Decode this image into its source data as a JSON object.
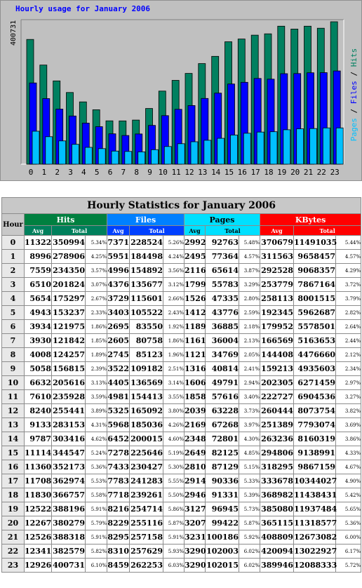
{
  "chart_title": "Hourly usage for January 2006",
  "table_title": "Hourly Statistics for January 2006",
  "headers": {
    "hour": "Hour",
    "hits": "Hits",
    "files": "Files",
    "pages": "Pages",
    "kbytes": "KBytes",
    "avg": "Avg",
    "total": "Total"
  },
  "colors": {
    "hits": "#008040",
    "files": "#0000ff",
    "pages": "#00c0ff",
    "kbytes": "#ff0000"
  },
  "chart_data": {
    "type": "bar",
    "title": "Hourly usage for January 2006",
    "categories": [
      "0",
      "1",
      "2",
      "3",
      "4",
      "5",
      "6",
      "7",
      "8",
      "9",
      "10",
      "11",
      "12",
      "13",
      "14",
      "15",
      "16",
      "17",
      "18",
      "19",
      "20",
      "21",
      "22",
      "23"
    ],
    "ymax_label": "400731",
    "ylim": [
      0,
      400731
    ],
    "legend": "Pages / Files / Hits",
    "series": [
      {
        "name": "Hits",
        "values": [
          350994,
          278906,
          234350,
          201824,
          175297,
          153237,
          121975,
          121842,
          124257,
          156815,
          205616,
          235928,
          255441,
          283153,
          303416,
          344547,
          352173,
          362974,
          366757,
          388196,
          380279,
          388318,
          382579,
          400731
        ]
      },
      {
        "name": "Files",
        "values": [
          228524,
          184498,
          154892,
          135677,
          115601,
          105522,
          85500,
          80758,
          85123,
          109182,
          136569,
          154413,
          165092,
          185036,
          200015,
          225646,
          230427,
          241283,
          239261,
          254714,
          255116,
          257158,
          257629,
          262253
        ]
      },
      {
        "name": "Pages",
        "values": [
          92763,
          77364,
          65614,
          55783,
          47335,
          43776,
          36885,
          36004,
          34769,
          40814,
          49791,
          57616,
          63228,
          67268,
          72801,
          82125,
          87129,
          90336,
          91331,
          96945,
          99422,
          100186,
          102003,
          102015
        ]
      }
    ]
  },
  "rows": [
    {
      "hour": "0",
      "hits_avg": "11322",
      "hits_total": "350994",
      "hits_pct": "5.34%",
      "files_avg": "7371",
      "files_total": "228524",
      "files_pct": "5.26%",
      "pages_avg": "2992",
      "pages_total": "92763",
      "pages_pct": "5.48%",
      "kb_avg": "370679",
      "kb_total": "11491035",
      "kb_pct": "5.44%"
    },
    {
      "hour": "1",
      "hits_avg": "8996",
      "hits_total": "278906",
      "hits_pct": "4.25%",
      "files_avg": "5951",
      "files_total": "184498",
      "files_pct": "4.24%",
      "pages_avg": "2495",
      "pages_total": "77364",
      "pages_pct": "4.57%",
      "kb_avg": "311563",
      "kb_total": "9658457",
      "kb_pct": "4.57%"
    },
    {
      "hour": "2",
      "hits_avg": "7559",
      "hits_total": "234350",
      "hits_pct": "3.57%",
      "files_avg": "4996",
      "files_total": "154892",
      "files_pct": "3.56%",
      "pages_avg": "2116",
      "pages_total": "65614",
      "pages_pct": "3.87%",
      "kb_avg": "292528",
      "kb_total": "9068357",
      "kb_pct": "4.29%"
    },
    {
      "hour": "3",
      "hits_avg": "6510",
      "hits_total": "201824",
      "hits_pct": "3.07%",
      "files_avg": "4376",
      "files_total": "135677",
      "files_pct": "3.12%",
      "pages_avg": "1799",
      "pages_total": "55783",
      "pages_pct": "3.29%",
      "kb_avg": "253779",
      "kb_total": "7867164",
      "kb_pct": "3.72%"
    },
    {
      "hour": "4",
      "hits_avg": "5654",
      "hits_total": "175297",
      "hits_pct": "2.67%",
      "files_avg": "3729",
      "files_total": "115601",
      "files_pct": "2.66%",
      "pages_avg": "1526",
      "pages_total": "47335",
      "pages_pct": "2.80%",
      "kb_avg": "258113",
      "kb_total": "8001515",
      "kb_pct": "3.79%"
    },
    {
      "hour": "5",
      "hits_avg": "4943",
      "hits_total": "153237",
      "hits_pct": "2.33%",
      "files_avg": "3403",
      "files_total": "105522",
      "files_pct": "2.43%",
      "pages_avg": "1412",
      "pages_total": "43776",
      "pages_pct": "2.59%",
      "kb_avg": "192345",
      "kb_total": "5962687",
      "kb_pct": "2.82%"
    },
    {
      "hour": "6",
      "hits_avg": "3934",
      "hits_total": "121975",
      "hits_pct": "1.86%",
      "files_avg": "2695",
      "files_total": "83550",
      "files_pct": "1.92%",
      "pages_avg": "1189",
      "pages_total": "36885",
      "pages_pct": "2.18%",
      "kb_avg": "179952",
      "kb_total": "5578501",
      "kb_pct": "2.64%"
    },
    {
      "hour": "7",
      "hits_avg": "3930",
      "hits_total": "121842",
      "hits_pct": "1.85%",
      "files_avg": "2605",
      "files_total": "80758",
      "files_pct": "1.86%",
      "pages_avg": "1161",
      "pages_total": "36004",
      "pages_pct": "2.13%",
      "kb_avg": "166569",
      "kb_total": "5163653",
      "kb_pct": "2.44%"
    },
    {
      "hour": "8",
      "hits_avg": "4008",
      "hits_total": "124257",
      "hits_pct": "1.89%",
      "files_avg": "2745",
      "files_total": "85123",
      "files_pct": "1.96%",
      "pages_avg": "1121",
      "pages_total": "34769",
      "pages_pct": "2.05%",
      "kb_avg": "144408",
      "kb_total": "4476660",
      "kb_pct": "2.12%"
    },
    {
      "hour": "9",
      "hits_avg": "5058",
      "hits_total": "156815",
      "hits_pct": "2.39%",
      "files_avg": "3522",
      "files_total": "109182",
      "files_pct": "2.51%",
      "pages_avg": "1316",
      "pages_total": "40814",
      "pages_pct": "2.41%",
      "kb_avg": "159213",
      "kb_total": "4935603",
      "kb_pct": "2.34%"
    },
    {
      "hour": "10",
      "hits_avg": "6632",
      "hits_total": "205616",
      "hits_pct": "3.13%",
      "files_avg": "4405",
      "files_total": "136569",
      "files_pct": "3.14%",
      "pages_avg": "1606",
      "pages_total": "49791",
      "pages_pct": "2.94%",
      "kb_avg": "202305",
      "kb_total": "6271459",
      "kb_pct": "2.97%"
    },
    {
      "hour": "11",
      "hits_avg": "7610",
      "hits_total": "235928",
      "hits_pct": "3.59%",
      "files_avg": "4981",
      "files_total": "154413",
      "files_pct": "3.55%",
      "pages_avg": "1858",
      "pages_total": "57616",
      "pages_pct": "3.40%",
      "kb_avg": "222727",
      "kb_total": "6904536",
      "kb_pct": "3.27%"
    },
    {
      "hour": "12",
      "hits_avg": "8240",
      "hits_total": "255441",
      "hits_pct": "3.89%",
      "files_avg": "5325",
      "files_total": "165092",
      "files_pct": "3.80%",
      "pages_avg": "2039",
      "pages_total": "63228",
      "pages_pct": "3.73%",
      "kb_avg": "260444",
      "kb_total": "8073754",
      "kb_pct": "3.82%"
    },
    {
      "hour": "13",
      "hits_avg": "9133",
      "hits_total": "283153",
      "hits_pct": "4.31%",
      "files_avg": "5968",
      "files_total": "185036",
      "files_pct": "4.26%",
      "pages_avg": "2169",
      "pages_total": "67268",
      "pages_pct": "3.97%",
      "kb_avg": "251389",
      "kb_total": "7793074",
      "kb_pct": "3.69%"
    },
    {
      "hour": "14",
      "hits_avg": "9787",
      "hits_total": "303416",
      "hits_pct": "4.62%",
      "files_avg": "6452",
      "files_total": "200015",
      "files_pct": "4.60%",
      "pages_avg": "2348",
      "pages_total": "72801",
      "pages_pct": "4.30%",
      "kb_avg": "263236",
      "kb_total": "8160319",
      "kb_pct": "3.86%"
    },
    {
      "hour": "15",
      "hits_avg": "11114",
      "hits_total": "344547",
      "hits_pct": "5.24%",
      "files_avg": "7278",
      "files_total": "225646",
      "files_pct": "5.19%",
      "pages_avg": "2649",
      "pages_total": "82125",
      "pages_pct": "4.85%",
      "kb_avg": "294806",
      "kb_total": "9138991",
      "kb_pct": "4.33%"
    },
    {
      "hour": "16",
      "hits_avg": "11360",
      "hits_total": "352173",
      "hits_pct": "5.36%",
      "files_avg": "7433",
      "files_total": "230427",
      "files_pct": "5.30%",
      "pages_avg": "2810",
      "pages_total": "87129",
      "pages_pct": "5.15%",
      "kb_avg": "318295",
      "kb_total": "9867159",
      "kb_pct": "4.67%"
    },
    {
      "hour": "17",
      "hits_avg": "11708",
      "hits_total": "362974",
      "hits_pct": "5.53%",
      "files_avg": "7783",
      "files_total": "241283",
      "files_pct": "5.55%",
      "pages_avg": "2914",
      "pages_total": "90336",
      "pages_pct": "5.33%",
      "kb_avg": "333678",
      "kb_total": "10344027",
      "kb_pct": "4.90%"
    },
    {
      "hour": "18",
      "hits_avg": "11830",
      "hits_total": "366757",
      "hits_pct": "5.58%",
      "files_avg": "7718",
      "files_total": "239261",
      "files_pct": "5.50%",
      "pages_avg": "2946",
      "pages_total": "91331",
      "pages_pct": "5.39%",
      "kb_avg": "368982",
      "kb_total": "11438431",
      "kb_pct": "5.42%"
    },
    {
      "hour": "19",
      "hits_avg": "12522",
      "hits_total": "388196",
      "hits_pct": "5.91%",
      "files_avg": "8216",
      "files_total": "254714",
      "files_pct": "5.86%",
      "pages_avg": "3127",
      "pages_total": "96945",
      "pages_pct": "5.73%",
      "kb_avg": "385080",
      "kb_total": "11937484",
      "kb_pct": "5.65%"
    },
    {
      "hour": "20",
      "hits_avg": "12267",
      "hits_total": "380279",
      "hits_pct": "5.79%",
      "files_avg": "8229",
      "files_total": "255116",
      "files_pct": "5.87%",
      "pages_avg": "3207",
      "pages_total": "99422",
      "pages_pct": "5.87%",
      "kb_avg": "365115",
      "kb_total": "11318577",
      "kb_pct": "5.36%"
    },
    {
      "hour": "21",
      "hits_avg": "12526",
      "hits_total": "388318",
      "hits_pct": "5.91%",
      "files_avg": "8295",
      "files_total": "257158",
      "files_pct": "5.91%",
      "pages_avg": "3231",
      "pages_total": "100186",
      "pages_pct": "5.92%",
      "kb_avg": "408809",
      "kb_total": "12673082",
      "kb_pct": "6.00%"
    },
    {
      "hour": "22",
      "hits_avg": "12341",
      "hits_total": "382579",
      "hits_pct": "5.82%",
      "files_avg": "8310",
      "files_total": "257629",
      "files_pct": "5.93%",
      "pages_avg": "3290",
      "pages_total": "102003",
      "pages_pct": "6.02%",
      "kb_avg": "420094",
      "kb_total": "13022927",
      "kb_pct": "6.17%"
    },
    {
      "hour": "23",
      "hits_avg": "12926",
      "hits_total": "400731",
      "hits_pct": "6.10%",
      "files_avg": "8459",
      "files_total": "262253",
      "files_pct": "6.03%",
      "pages_avg": "3290",
      "pages_total": "102015",
      "pages_pct": "6.02%",
      "kb_avg": "389946",
      "kb_total": "12088333",
      "kb_pct": "5.72%"
    }
  ]
}
